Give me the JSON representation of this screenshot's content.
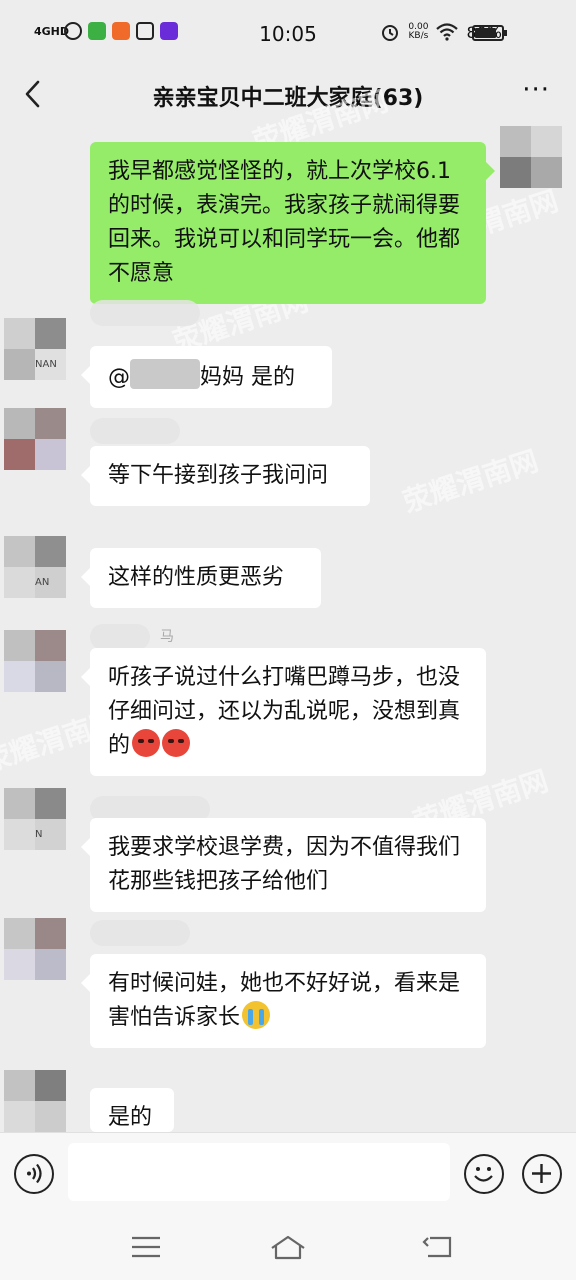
{
  "status_bar": {
    "network": "4GHD",
    "time": "10:05",
    "speed_value": "0.00",
    "speed_unit": "KB/s",
    "battery": "80%",
    "battery_level": 0.8
  },
  "header": {
    "title": "亲亲宝贝中二班大家庭(63)",
    "more": "···"
  },
  "messages": [
    {
      "from": "self",
      "text": "我早都感觉怪怪的，就上次学校6.1的时候，表演完。我家孩子就闹得要回来。我说可以和同学玩一会。他都不愿意"
    },
    {
      "from": "other",
      "prefix": "@",
      "suffix": "妈妈  是的",
      "avatar_text": "NAN"
    },
    {
      "from": "other",
      "text": "等下午接到孩子我问问"
    },
    {
      "from": "other",
      "text": "这样的性质更恶劣",
      "avatar_text": "AN"
    },
    {
      "from": "other",
      "nick_fragment": "马",
      "text": "听孩子说过什么打嘴巴蹲马步，也没仔细问过，还以为乱说呢，没想到真的"
    },
    {
      "from": "other",
      "text": "我要求学校退学费，因为不值得我们花那些钱把孩子给他们",
      "avatar_text": "N"
    },
    {
      "from": "other",
      "text": "有时候问娃，她也不好好说，看来是害怕告诉家长"
    },
    {
      "from": "other",
      "text": "是的"
    }
  ],
  "emojis": [
    "angry-face",
    "angry-face",
    "crying-face"
  ],
  "watermark": "荥耀渭南网",
  "colors": {
    "background": "#ededed",
    "self_bubble": "#95ec69",
    "other_bubble": "#ffffff"
  }
}
